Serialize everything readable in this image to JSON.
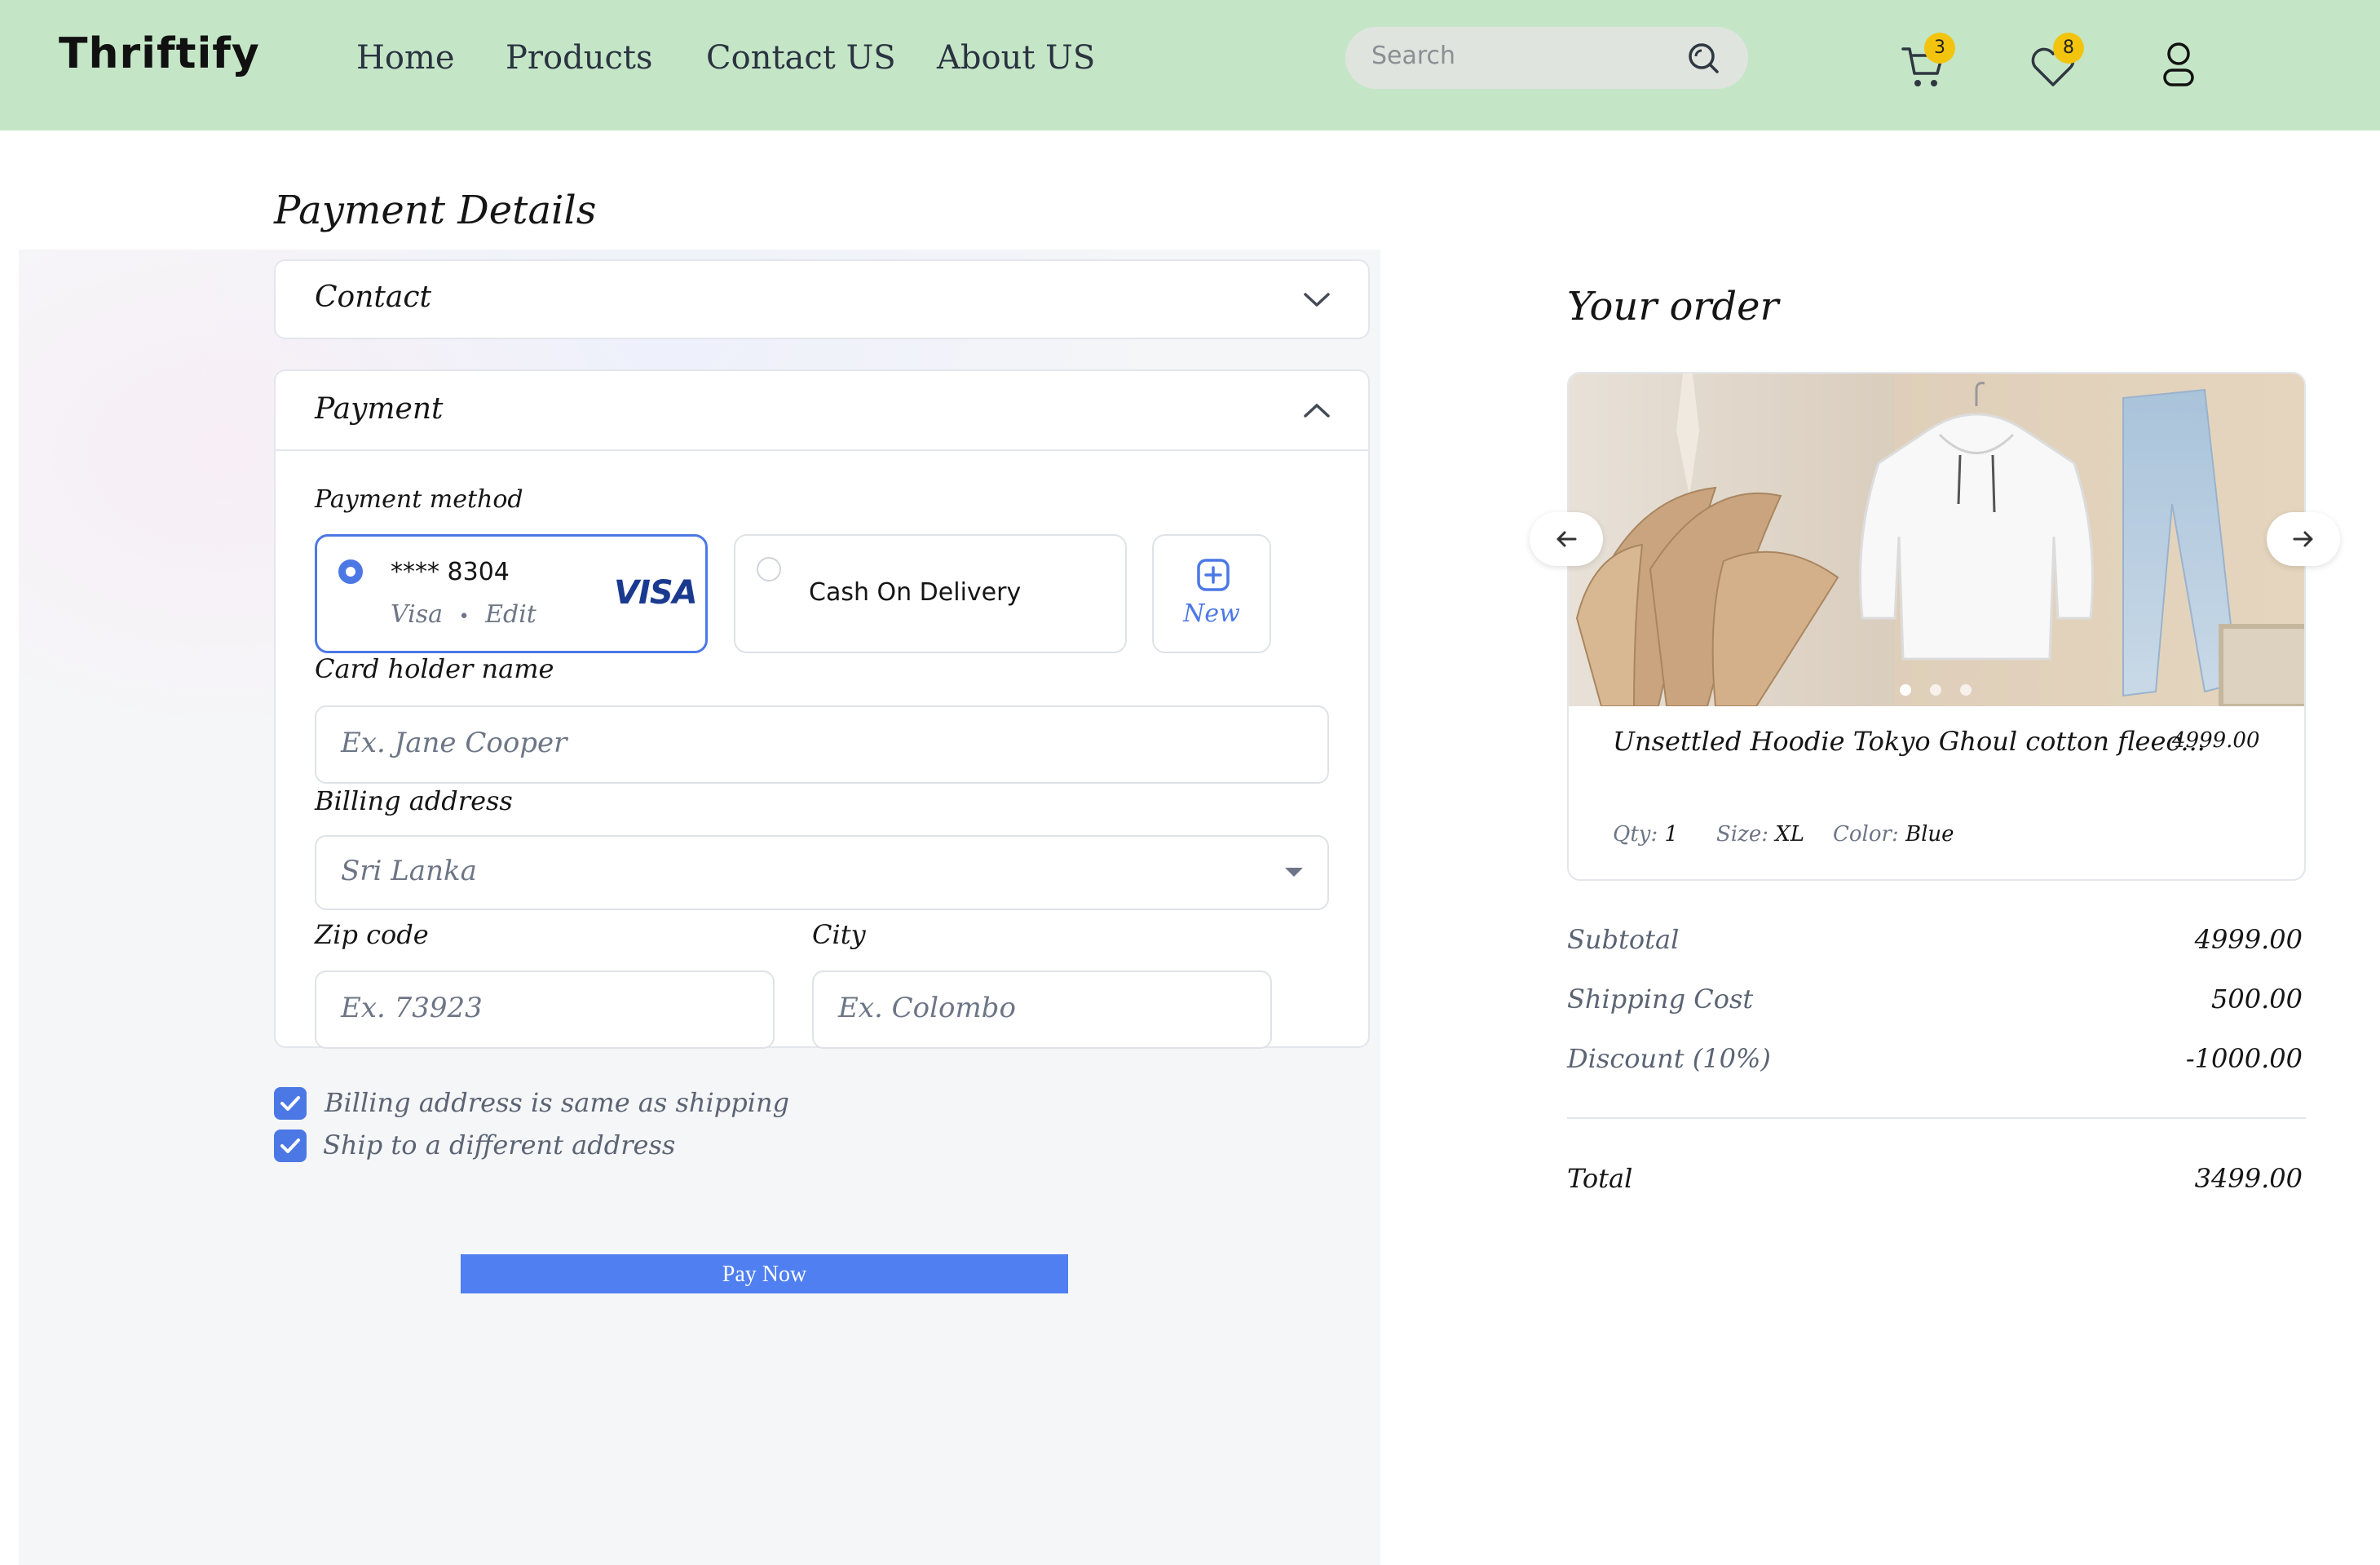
{
  "brand": {
    "name": "Thriftify"
  },
  "nav": {
    "links": [
      "Home",
      "Products",
      "Contact US",
      "About US"
    ],
    "search_placeholder": "Search",
    "cart_count": "3",
    "wishlist_count": "8"
  },
  "payment": {
    "title": "Payment Details",
    "contact_section": "Contact",
    "payment_section": "Payment",
    "method_label": "Payment method",
    "card": {
      "number": "**** 8304",
      "type": "Visa",
      "separator": "•",
      "edit": "Edit",
      "brand": "VISA"
    },
    "cod_label": "Cash On Delivery",
    "new_label": "New",
    "card_holder_label": "Card holder name",
    "card_holder_placeholder": "Ex. Jane Cooper",
    "billing_label": "Billing address",
    "billing_value": "Sri Lanka",
    "zip_label": "Zip code",
    "zip_placeholder": "Ex. 73923",
    "city_label": "City",
    "city_placeholder": "Ex. Colombo",
    "same_as_shipping": "Billing address is same as shipping",
    "ship_different": "Ship to a different address",
    "pay_button": "Pay Now"
  },
  "order": {
    "title": "Your order",
    "product": {
      "name": "Unsettled Hoodie Tokyo Ghoul cotton fleec...",
      "price": "4999.00",
      "qty_label": "Qty:",
      "qty": "1",
      "size_label": "Size:",
      "size": "XL",
      "color_label": "Color:",
      "color": "Blue"
    },
    "summary": {
      "subtotal_label": "Subtotal",
      "subtotal": "4999.00",
      "shipping_label": "Shipping Cost",
      "shipping": "500.00",
      "discount_label": "Discount (10%)",
      "discount": "-1000.00",
      "total_label": "Total",
      "total": "3499.00"
    }
  },
  "colors": {
    "navbar": "#c4e6c7",
    "accent": "#4c78e6",
    "badge": "#f2c40e",
    "visa": "#1a3a8f"
  },
  "icons": [
    "search-icon",
    "cart-icon",
    "heart-icon",
    "user-icon",
    "chevron-down-icon",
    "chevron-up-icon",
    "plus-square-icon",
    "arrow-left-icon",
    "arrow-right-icon",
    "check-icon",
    "caret-down-icon"
  ]
}
